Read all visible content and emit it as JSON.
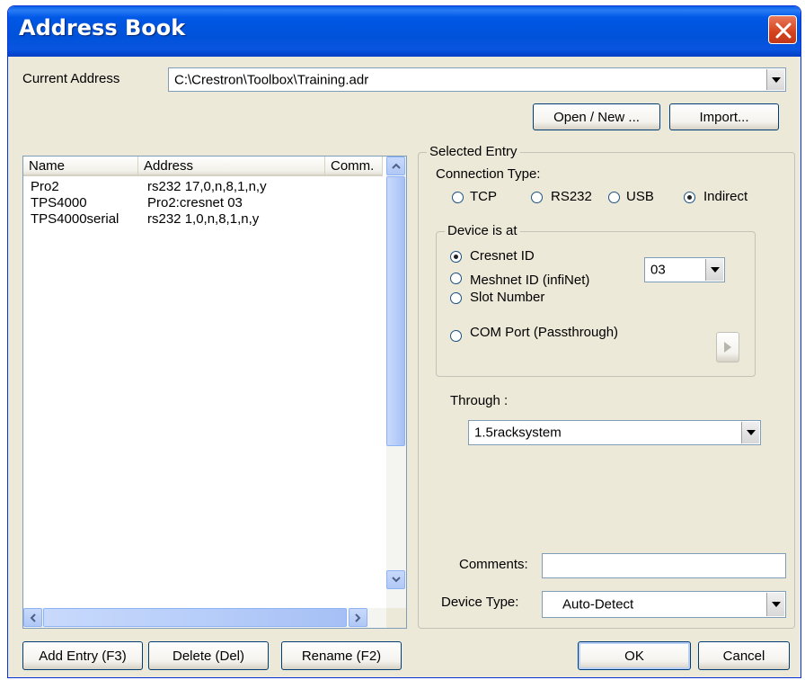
{
  "window": {
    "title": "Address Book"
  },
  "current_address": {
    "label": "Current Address",
    "value": "C:\\Crestron\\Toolbox\\Training.adr"
  },
  "buttons": {
    "open_new": "Open / New ...",
    "import": "Import...",
    "add_entry": "Add Entry (F3)",
    "delete": "Delete (Del)",
    "rename": "Rename (F2)",
    "ok": "OK",
    "cancel": "Cancel"
  },
  "list": {
    "columns": [
      "Name",
      "Address",
      "Comm."
    ],
    "rows": [
      {
        "name": "Pro2",
        "address": "rs232 17,0,n,8,1,n,y"
      },
      {
        "name": "TPS4000",
        "address": "Pro2:cresnet 03"
      },
      {
        "name": "TPS4000serial",
        "address": "rs232 1,0,n,8,1,n,y"
      }
    ]
  },
  "selected_entry": {
    "caption": "Selected Entry",
    "connection_type_label": "Connection Type:",
    "connection_types": [
      "TCP",
      "RS232",
      "USB",
      "Indirect"
    ],
    "connection_selected": "Indirect",
    "device_group_caption": "Device is at",
    "device_options": [
      "Cresnet ID",
      "Meshnet ID (infiNet)",
      "Slot Number",
      "COM Port (Passthrough)"
    ],
    "device_selected": "Cresnet ID",
    "id_value": "03",
    "through_label": "Through :",
    "through_value": "1.5racksystem",
    "comments_label": "Comments:",
    "comments_value": "",
    "device_type_label": "Device Type:",
    "device_type_value": "Auto-Detect"
  },
  "colors": {
    "titlebar": "#0058e6",
    "window_bg": "#ece9d8",
    "close_button": "#d4421c"
  }
}
